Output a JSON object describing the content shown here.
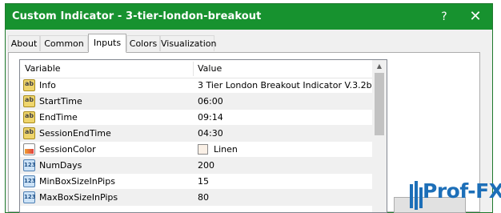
{
  "window": {
    "title": "Custom Indicator - 3-tier-london-breakout",
    "help_label": "?",
    "close_label": "✕"
  },
  "tabs": [
    {
      "label": "About",
      "active": false
    },
    {
      "label": "Common",
      "active": false
    },
    {
      "label": "Inputs",
      "active": true
    },
    {
      "label": "Colors",
      "active": false
    },
    {
      "label": "Visualization",
      "active": false
    }
  ],
  "grid": {
    "columns": [
      "Variable",
      "Value"
    ],
    "rows": [
      {
        "icon": "ab-string-icon",
        "name": "Info",
        "value": "3 Tier London Breakout Indicator V.3.2b"
      },
      {
        "icon": "ab-string-icon",
        "name": "StartTime",
        "value": "06:00"
      },
      {
        "icon": "ab-string-icon",
        "name": "EndTime",
        "value": "09:14"
      },
      {
        "icon": "ab-string-icon",
        "name": "SessionEndTime",
        "value": "04:30"
      },
      {
        "icon": "color-icon",
        "name": "SessionColor",
        "value": "Linen",
        "swatch": "#faf0e6"
      },
      {
        "icon": "number-icon",
        "name": "NumDays",
        "value": "200"
      },
      {
        "icon": "number-icon",
        "name": "MinBoxSizeInPips",
        "value": "15"
      },
      {
        "icon": "number-icon",
        "name": "MaxBoxSizeInPips",
        "value": "80"
      }
    ]
  },
  "watermark": {
    "text": "Prof-FX"
  },
  "colors": {
    "title_bar": "#17922f",
    "watermark": "#1d6fb8"
  }
}
